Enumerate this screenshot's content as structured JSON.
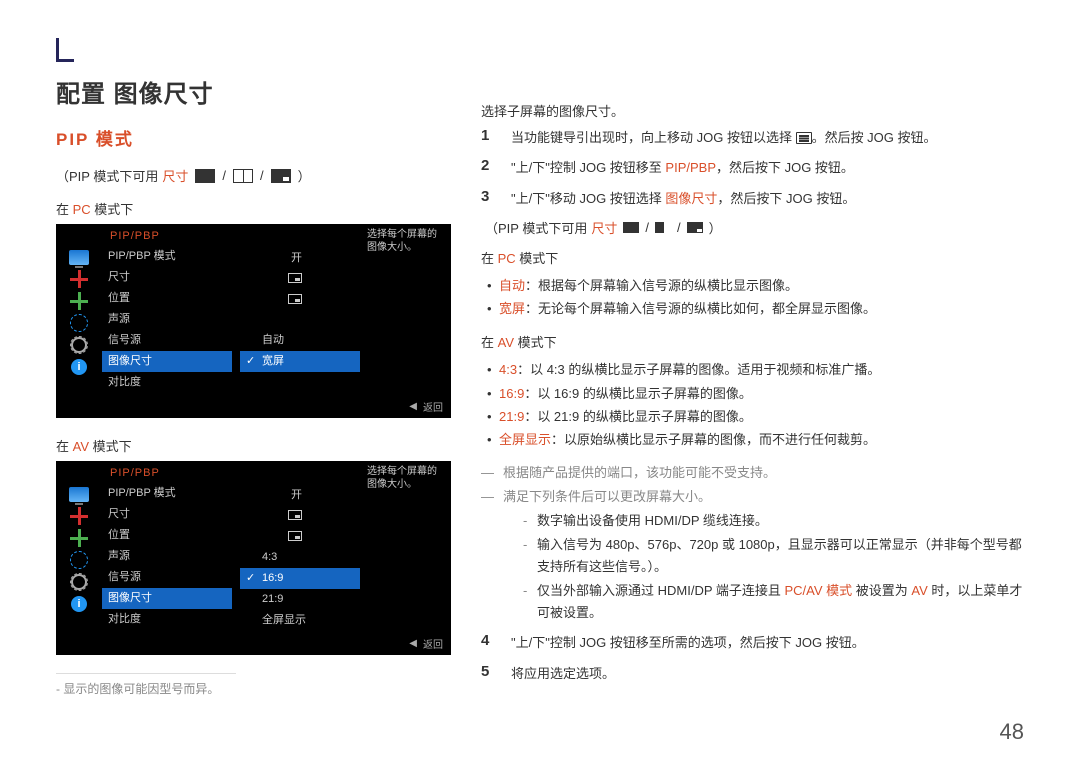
{
  "page_number": "48",
  "left": {
    "title": "配置 图像尺寸",
    "subtitle": "PIP 模式",
    "sizes_prefix": "（PIP 模式下可用",
    "sizes_label": "尺寸",
    "sizes_suffix": "）",
    "slash": " / ",
    "pc_mode_prefix": "在 ",
    "pc_mode_word": "PC",
    "pc_mode_suffix": " 模式下",
    "av_mode_prefix": "在 ",
    "av_mode_word": "AV",
    "av_mode_suffix": " 模式下",
    "footnote": "- 显示的图像可能因型号而异。"
  },
  "osd": {
    "title": "PIP/PBP",
    "desc": "选择每个屏幕的图像大小。",
    "items": [
      {
        "label": "PIP/PBP 模式",
        "value": "开"
      },
      {
        "label": "尺寸",
        "value": ""
      },
      {
        "label": "位置",
        "value": ""
      },
      {
        "label": "声源",
        "value": ""
      },
      {
        "label": "信号源",
        "value": ""
      },
      {
        "label": "图像尺寸",
        "value": ""
      },
      {
        "label": "对比度",
        "value": ""
      }
    ],
    "selected_index": 5,
    "pc_sub": [
      {
        "label": "自动",
        "selected": false
      },
      {
        "label": "宽屏",
        "selected": true
      }
    ],
    "av_sub": [
      {
        "label": "4:3",
        "selected": false
      },
      {
        "label": "16:9",
        "selected": true
      },
      {
        "label": "21:9",
        "selected": false
      },
      {
        "label": "全屏显示",
        "selected": false
      }
    ],
    "back": "返回"
  },
  "right": {
    "intro": "选择子屏幕的图像尺寸。",
    "step1_a": "当功能键导引出现时，向上移动 JOG 按钮以选择 ",
    "step1_b": "。然后按 JOG 按钮。",
    "step2_a": "\"上/下\"控制 JOG 按钮移至 ",
    "step2_hl": "PIP/PBP",
    "step2_b": "，然后按下 JOG 按钮。",
    "step3_a": "\"上/下\"移动 JOG 按钮选择 ",
    "step3_hl": "图像尺寸",
    "step3_b": "，然后按下 JOG 按钮。",
    "sizes_prefix": "（PIP 模式下可用",
    "sizes_label": "尺寸",
    "sizes_suffix": "）",
    "pc_mode_prefix": "在 ",
    "pc_mode_word": "PC",
    "pc_mode_suffix": " 模式下",
    "pc_bullets": [
      {
        "hl": "自动",
        "text": "：根据每个屏幕输入信号源的纵横比显示图像。"
      },
      {
        "hl": "宽屏",
        "text": "：无论每个屏幕输入信号源的纵横比如何，都全屏显示图像。"
      }
    ],
    "av_mode_prefix": "在 ",
    "av_mode_word": "AV",
    "av_mode_suffix": " 模式下",
    "av_bullets": [
      {
        "hl": "4:3",
        "text": "：以 4:3 的纵横比显示子屏幕的图像。适用于视频和标准广播。"
      },
      {
        "hl": "16:9",
        "text": "：以 16:9 的纵横比显示子屏幕的图像。"
      },
      {
        "hl": "21:9",
        "text": "：以 21:9 的纵横比显示子屏幕的图像。"
      },
      {
        "hl": "全屏显示",
        "text": "：以原始纵横比显示子屏幕的图像，而不进行任何裁剪。"
      }
    ],
    "note1": "根据随产品提供的端口，该功能可能不受支持。",
    "note2": "满足下列条件后可以更改屏幕大小。",
    "sub1": "数字输出设备使用 HDMI/DP 缆线连接。",
    "sub2": "输入信号为 480p、576p、720p 或 1080p，且显示器可以正常显示（并非每个型号都支持所有这些信号。）。",
    "sub3_a": "仅当外部输入源通过 HDMI/DP 端子连接且 ",
    "sub3_hl1": "PC/AV 模式",
    "sub3_b": " 被设置为 ",
    "sub3_hl2": "AV",
    "sub3_c": " 时，以上菜单才可被设置。",
    "step4": "\"上/下\"控制 JOG 按钮移至所需的选项，然后按下 JOG 按钮。",
    "step5": "将应用选定选项。"
  }
}
